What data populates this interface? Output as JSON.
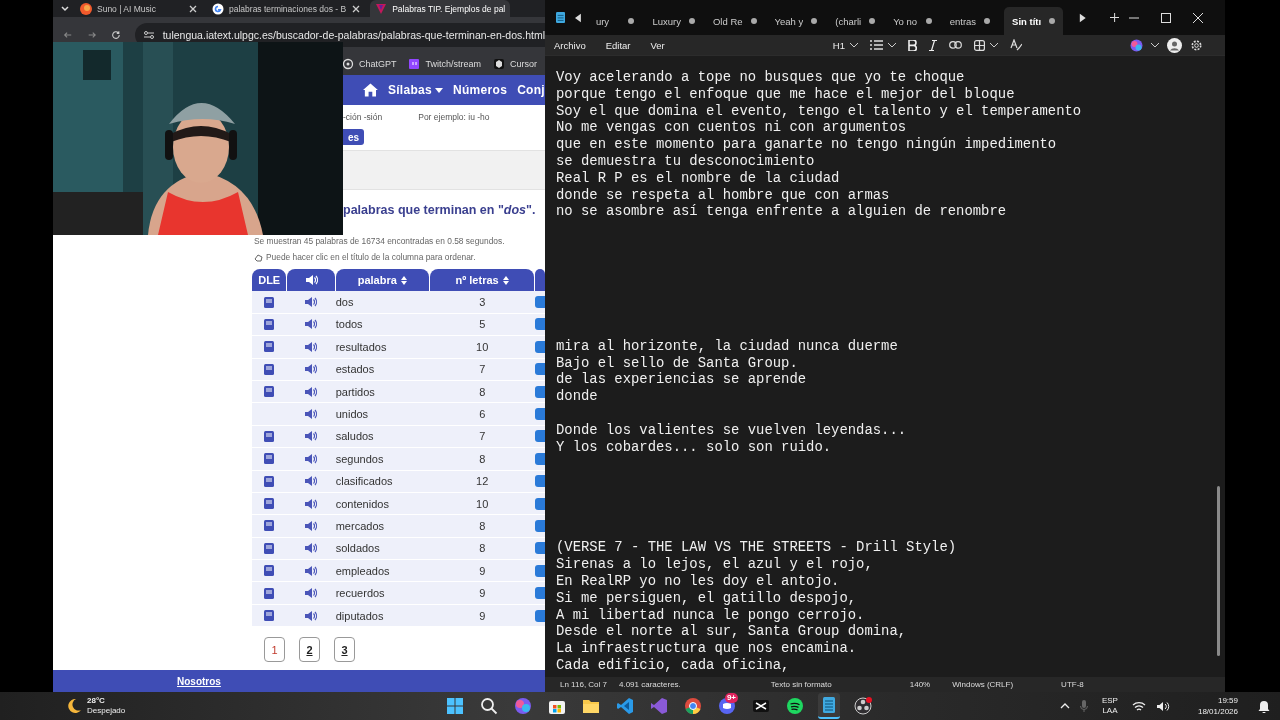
{
  "browser": {
    "tabs": [
      {
        "title": "Suno | AI Music",
        "selected": false,
        "closable": true
      },
      {
        "title": "palabras terminaciones dos - B",
        "selected": false,
        "closable": true
      },
      {
        "title": "Palabras TIP. Ejemplos de pal",
        "selected": true,
        "closable": false
      }
    ],
    "address": "tulengua.iatext.ulpgc.es/buscador-de-palabras/palabras-que-terminan-en-dos.html",
    "bookmarks": [
      {
        "label": "ChatGPT"
      },
      {
        "label": "Twitch/stream"
      },
      {
        "label": "Cursor"
      }
    ],
    "site_nav": [
      {
        "kind": "home"
      },
      {
        "kind": "dropdown",
        "label": "Sílabas"
      },
      {
        "kind": "link",
        "label": "Números"
      },
      {
        "kind": "link",
        "label": "Conj"
      }
    ],
    "search_hint": "-ción -sión",
    "example_hint": "Por ejemplo: iu -ho",
    "search_button": "es",
    "heading": "palabras que terminan en \"*dos*\".",
    "summary": "Se muestran 45 palabras de 16734 encontradas en 0.58 segundos.",
    "sort_hint": "Puede hacer clic en el título de la columna para ordenar.",
    "table": {
      "columns": [
        {
          "kind": "text",
          "label": "DLE",
          "sortable": false
        },
        {
          "kind": "audio",
          "sortable": false
        },
        {
          "kind": "text",
          "label": "palabra",
          "sortable": true
        },
        {
          "kind": "text",
          "label": "nº letras",
          "sortable": true
        }
      ],
      "rows": [
        {
          "dle": true,
          "word": "dos",
          "letters": "3"
        },
        {
          "dle": true,
          "word": "todos",
          "letters": "5"
        },
        {
          "dle": true,
          "word": "resultados",
          "letters": "10"
        },
        {
          "dle": true,
          "word": "estados",
          "letters": "7"
        },
        {
          "dle": true,
          "word": "partidos",
          "letters": "8"
        },
        {
          "dle": false,
          "word": "unidos",
          "letters": "6"
        },
        {
          "dle": true,
          "word": "saludos",
          "letters": "7"
        },
        {
          "dle": true,
          "word": "segundos",
          "letters": "8"
        },
        {
          "dle": true,
          "word": "clasificados",
          "letters": "12"
        },
        {
          "dle": true,
          "word": "contenidos",
          "letters": "10"
        },
        {
          "dle": true,
          "word": "mercados",
          "letters": "8"
        },
        {
          "dle": true,
          "word": "soldados",
          "letters": "8"
        },
        {
          "dle": true,
          "word": "empleados",
          "letters": "9"
        },
        {
          "dle": true,
          "word": "recuerdos",
          "letters": "9"
        },
        {
          "dle": true,
          "word": "diputados",
          "letters": "9"
        }
      ]
    },
    "pagination": [
      {
        "label": "1",
        "selected": true
      },
      {
        "label": "2",
        "selected": false
      },
      {
        "label": "3",
        "selected": false
      }
    ],
    "footer_link": "Nosotros"
  },
  "notepad": {
    "tabs": [
      {
        "title": "ury",
        "selected": false,
        "unsaved": true
      },
      {
        "title": "Luxury",
        "selected": false,
        "unsaved": true
      },
      {
        "title": "Old Re",
        "selected": false,
        "unsaved": true
      },
      {
        "title": "Yeah y",
        "selected": false,
        "unsaved": true
      },
      {
        "title": "(charli",
        "selected": false,
        "unsaved": true
      },
      {
        "title": "Yo no",
        "selected": false,
        "unsaved": true
      },
      {
        "title": "entras",
        "selected": false,
        "unsaved": true
      },
      {
        "title": "Sin títı",
        "selected": true,
        "unsaved": true
      }
    ],
    "menu": [
      "Archivo",
      "Editar",
      "Ver"
    ],
    "heading_level": "H1",
    "text": "Voy acelerando a tope no busques que yo te choque\nporque tengo el enfoque que me hace el mejor del bloque\nSoy el que domina el evento, tengo el talento y el temperamento\nNo me vengas con cuentos ni con argumentos\nque en este momento para ganarte no tengo ningún impedimento\nse demuestra tu desconocimiento\nReal R P es el nombre de la ciudad\ndonde se respeta al hombre que con armas\nno se asombre así tenga enfrente a alguien de renombre\n\n\n\n\n\n\n\nmira al horizonte, la ciudad nunca duerme\nBajo el sello de Santa Group.\nde las experiencias se aprende\ndonde \n\nDonde los valientes se vuelven leyendas...\nY los cobardes... solo son ruido.\n\n\n\n\n\n(VERSE 7 - THE LAW VS THE STREETS - Drill Style)\nSirenas a lo lejos, el azul y el rojo,\nEn RealRP yo no les doy el antojo.\nSi me persiguen, el gatillo despojo,\nA mi libertad nunca le pongo cerrojo.\nDesde el norte al sur, Santa Group domina,\nLa infraestructura que nos encamina.\nCada edificio, cada oficina,",
    "status": [
      {
        "kind": "position",
        "label": "Ln 116, Col 7"
      },
      {
        "kind": "count",
        "label": "4.091 caracteres."
      },
      {
        "kind": "format",
        "label": "Texto sin formato"
      },
      {
        "kind": "zoom",
        "label": "140%"
      },
      {
        "kind": "eol",
        "label": "Windows (CRLF)"
      },
      {
        "kind": "encoding",
        "label": "UTF-8"
      }
    ]
  },
  "taskbar": {
    "weather": {
      "temperature": "28°C",
      "condition": "Despejado"
    },
    "apps": [
      {
        "kind": "start",
        "active": false
      },
      {
        "kind": "search",
        "active": false
      },
      {
        "kind": "copilot",
        "active": false
      },
      {
        "kind": "store",
        "active": false
      },
      {
        "kind": "files",
        "active": false
      },
      {
        "kind": "vscode",
        "active": false
      },
      {
        "kind": "visualstudio",
        "active": false
      },
      {
        "kind": "chrome",
        "active": false
      },
      {
        "kind": "discord",
        "active": false,
        "badge": "9+"
      },
      {
        "kind": "capcut",
        "active": false
      },
      {
        "kind": "spotify",
        "active": false
      },
      {
        "kind": "notepad",
        "active": true
      },
      {
        "kind": "obs",
        "active": false
      }
    ],
    "language": "ESP",
    "layout": "LAA",
    "time": "19:59",
    "date": "18/01/2026"
  }
}
